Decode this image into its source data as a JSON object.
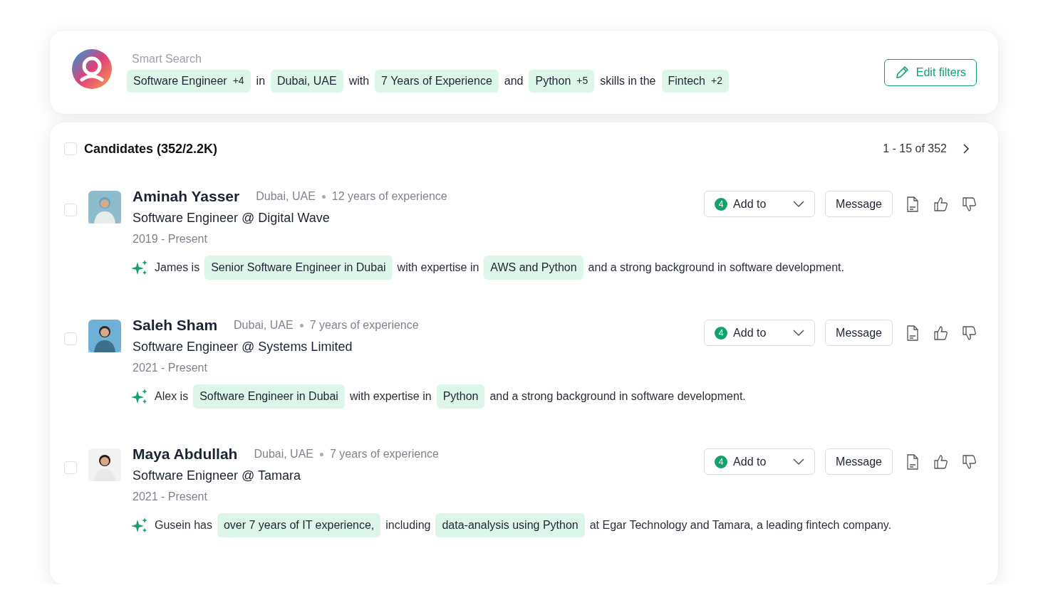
{
  "smart_search": {
    "label": "Smart Search",
    "query": [
      {
        "kind": "chip",
        "text": "Software Engineer",
        "count": "+4"
      },
      {
        "kind": "word",
        "text": "in"
      },
      {
        "kind": "chip",
        "text": "Dubai, UAE"
      },
      {
        "kind": "word",
        "text": "with"
      },
      {
        "kind": "chip",
        "text": "7 Years of Experience"
      },
      {
        "kind": "word",
        "text": "and"
      },
      {
        "kind": "chip",
        "text": "Python",
        "count": "+5"
      },
      {
        "kind": "word",
        "text": "skills in the"
      },
      {
        "kind": "chip",
        "text": "Fintech",
        "count": "+2"
      }
    ],
    "edit_button": "Edit filters"
  },
  "candidates": {
    "title": "Candidates (352/2.2K)",
    "checked": false,
    "pagination": "1 - 15 of 352",
    "rows": [
      {
        "name": "Aminah Yasser",
        "location": "Dubai, UAE",
        "experience": "12 years of experience",
        "role": "Software Engineer @ Digital Wave",
        "period": "2019 - Present",
        "checked": false,
        "add_count": "4",
        "add_label": "Add to",
        "message": "Message",
        "summary": [
          {
            "text": "James is",
            "highlight": false
          },
          {
            "text": "Senior Software Engineer in Dubai",
            "highlight": true
          },
          {
            "text": "with  expertise in",
            "highlight": false
          },
          {
            "text": "AWS and Python",
            "highlight": true
          },
          {
            "text": "and a strong background in software development.",
            "highlight": false
          }
        ]
      },
      {
        "name": "Saleh Sham",
        "location": "Dubai, UAE",
        "experience": "7 years of experience",
        "role": "Software Engineer @ Systems Limited",
        "period": "2021 - Present",
        "checked": false,
        "add_count": "4",
        "add_label": "Add to",
        "message": "Message",
        "summary": [
          {
            "text": "Alex is",
            "highlight": false
          },
          {
            "text": "Software Engineer in Dubai",
            "highlight": true
          },
          {
            "text": "with expertise in",
            "highlight": false
          },
          {
            "text": "Python",
            "highlight": true
          },
          {
            "text": "and a strong background in software development.",
            "highlight": false
          }
        ]
      },
      {
        "name": "Maya Abdullah",
        "location": "Dubai, UAE",
        "experience": "7 years of experience",
        "role": "Software Enigneer @ Tamara",
        "period": "2021 - Present",
        "checked": false,
        "add_count": "4",
        "add_label": "Add to",
        "message": "Message",
        "summary": [
          {
            "text": "Gusein has",
            "highlight": false
          },
          {
            "text": "over 7 years of IT experience,",
            "highlight": true
          },
          {
            "text": "including",
            "highlight": false
          },
          {
            "text": "data-analysis using Python",
            "highlight": true
          },
          {
            "text": "at Egar Technology and Tamara, a leading fintech company.",
            "highlight": false
          }
        ]
      }
    ]
  }
}
